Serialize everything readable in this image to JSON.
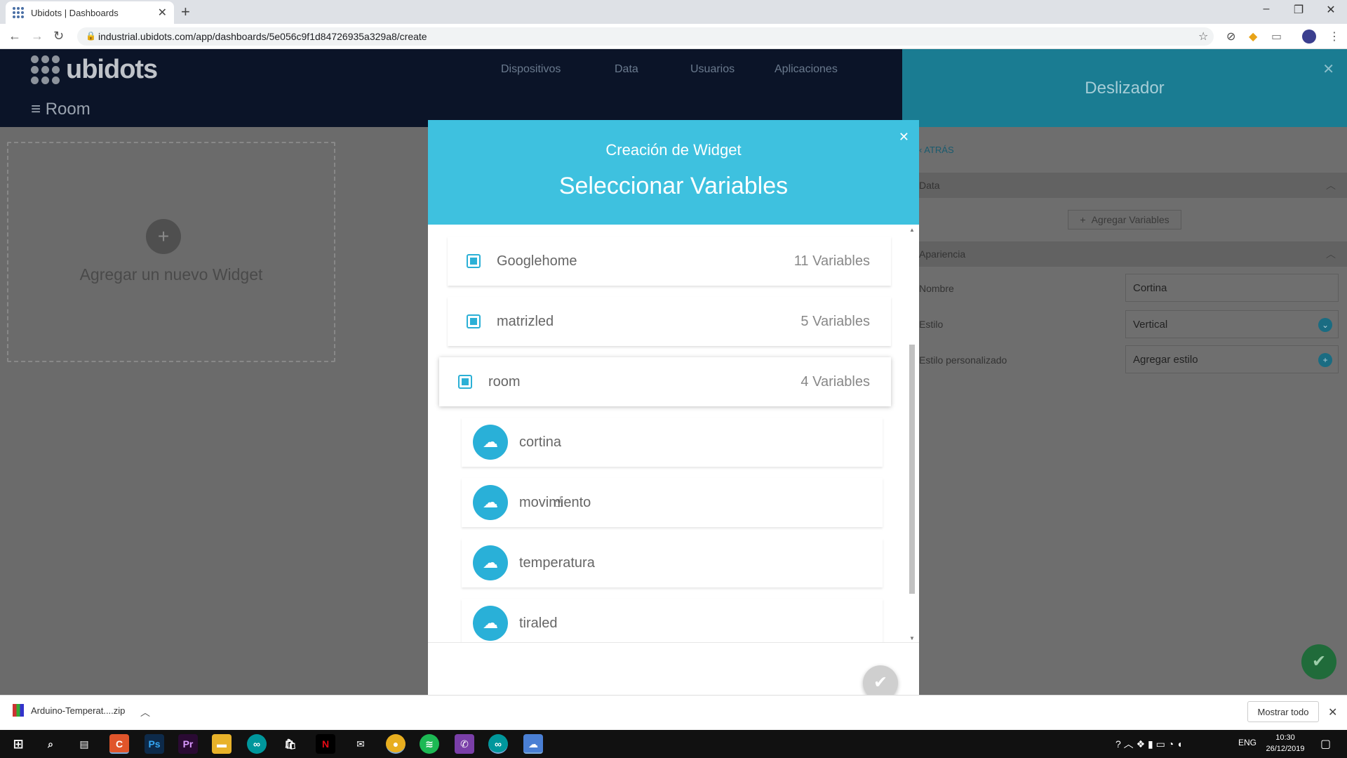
{
  "browser": {
    "tab_title": "Ubidots | Dashboards",
    "url": "industrial.ubidots.com/app/dashboards/5e056c9f1d84726935a329a8/create"
  },
  "app": {
    "logo_text": "ubidots",
    "nav": [
      "Dispositivos",
      "Data",
      "Usuarios",
      "Aplicaciones"
    ],
    "dashboard_name": "Room",
    "add_widget_label": "Agregar un nuevo Widget"
  },
  "side_panel": {
    "title": "Deslizador",
    "back_label": "ATRÁS",
    "data_section": "Data",
    "add_variables_label": "Agregar Variables",
    "appearance_section": "Apariencia",
    "name_label": "Nombre",
    "name_value": "Cortina",
    "style_label": "Estilo",
    "style_value": "Vertical",
    "custom_style_label": "Estilo personalizado",
    "custom_style_value": "Agregar estilo"
  },
  "modal": {
    "subtitle": "Creación de Widget",
    "title": "Seleccionar Variables",
    "devices": [
      {
        "name": "Googlehome",
        "count": "11 Variables"
      },
      {
        "name": "matrizled",
        "count": "5 Variables"
      },
      {
        "name": "room",
        "count": "4 Variables",
        "selected": true
      }
    ],
    "variables": [
      "cortina",
      "movimiento",
      "temperatura",
      "tiraled"
    ]
  },
  "download_bar": {
    "file_name": "Arduino-Temperat....zip",
    "show_all_label": "Mostrar todo"
  },
  "taskbar": {
    "language": "ENG",
    "time": "10:30",
    "date": "26/12/2019"
  },
  "colors": {
    "modal_header": "#3ec1df",
    "accent": "#29b0d8",
    "panel_header": "#1a7c92"
  }
}
